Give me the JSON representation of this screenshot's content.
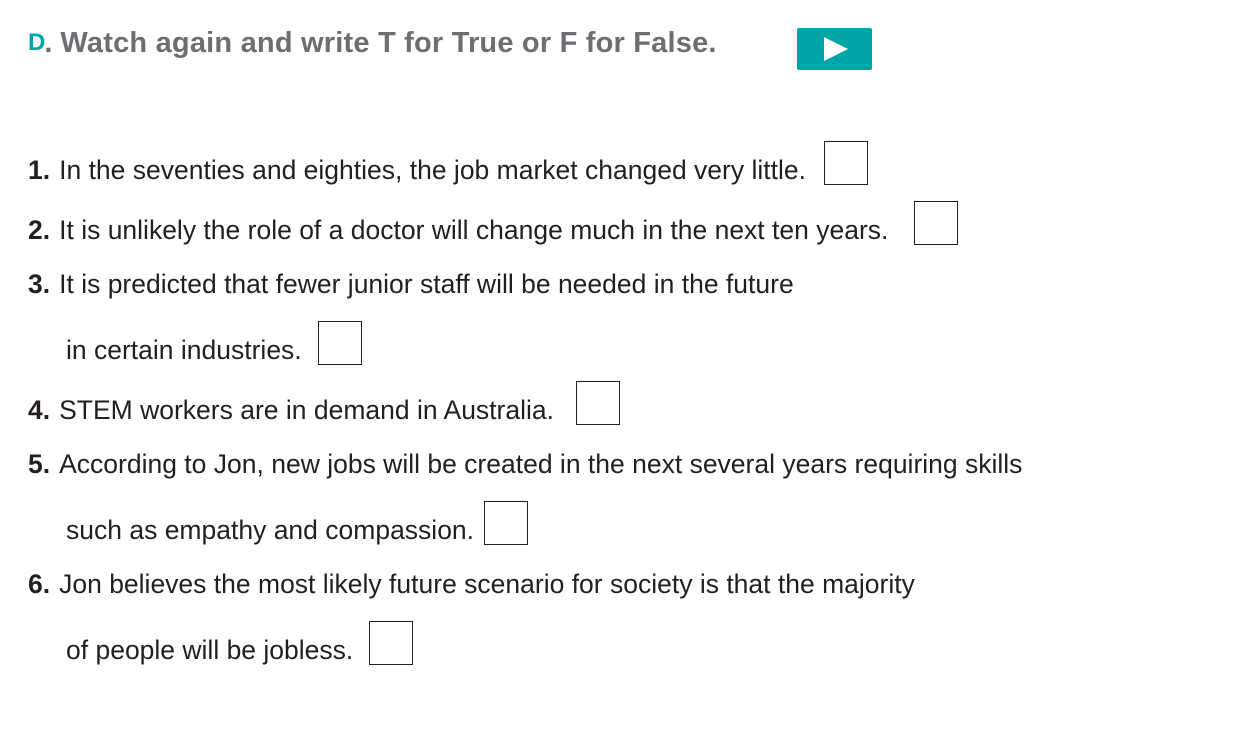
{
  "header": {
    "section_letter": "D",
    "section_dot": ".",
    "title": "Watch again and write T for True or F for False."
  },
  "play_button": {
    "icon": "play-icon",
    "color": "#00a5a8"
  },
  "questions": [
    {
      "number": "1.",
      "lines": [
        "In the seventies and eighties, the job market changed very little."
      ]
    },
    {
      "number": "2.",
      "lines": [
        "It is unlikely the role of a doctor will change much in the next ten years."
      ]
    },
    {
      "number": "3.",
      "lines": [
        "It is predicted that fewer junior staff will be needed in the future",
        "in certain industries."
      ]
    },
    {
      "number": "4.",
      "lines": [
        "STEM workers are in demand in Australia."
      ]
    },
    {
      "number": "5.",
      "lines": [
        "According to Jon, new jobs will be created in the next several years requiring skills",
        "such as empathy and compassion."
      ]
    },
    {
      "number": "6.",
      "lines": [
        "Jon believes the most likely future scenario for society is that the majority",
        "of people will be jobless."
      ]
    }
  ],
  "colors": {
    "accent": "#00a5a8",
    "heading": "#6d6e71",
    "text": "#231f20"
  }
}
